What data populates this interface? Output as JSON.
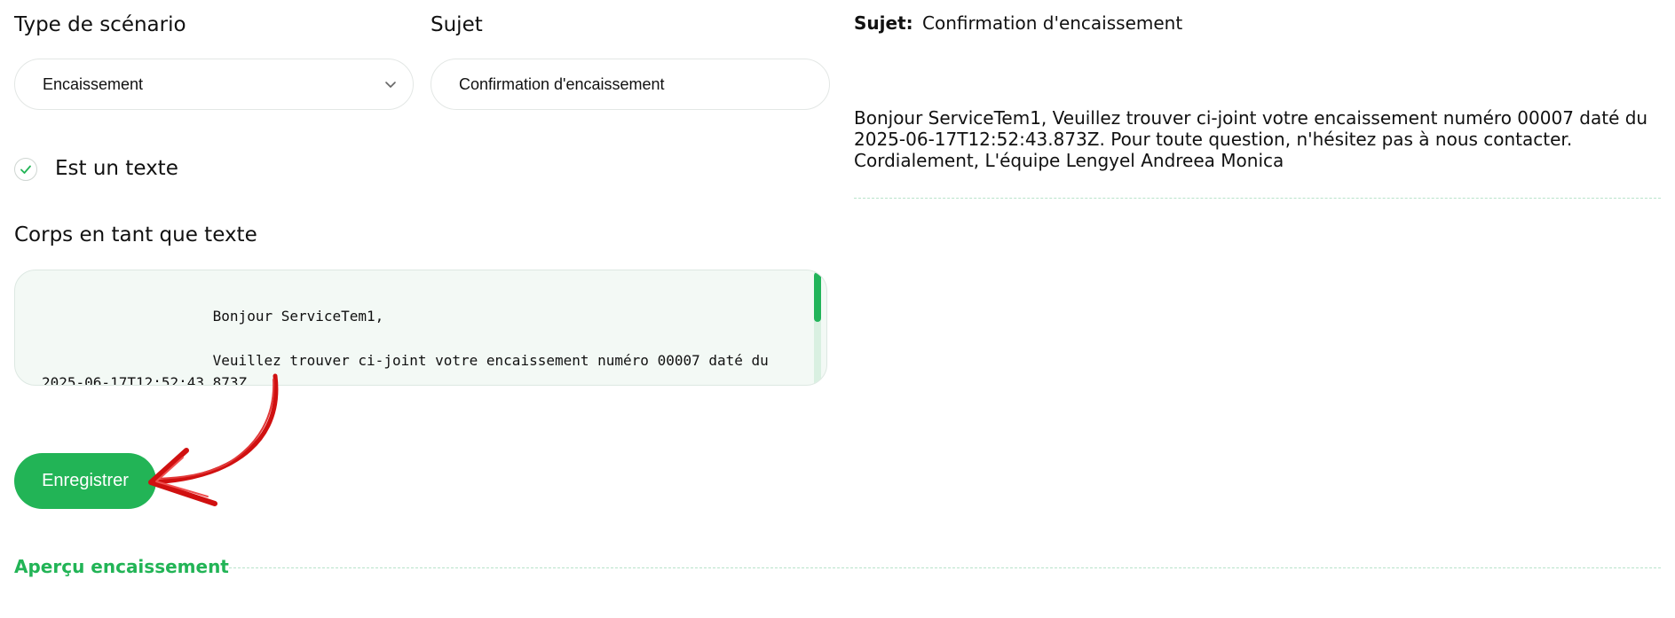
{
  "form": {
    "scenario_type_label": "Type de scénario",
    "scenario_type_value": "Encaissement",
    "subject_label": "Sujet",
    "subject_value": "Confirmation d'encaissement",
    "is_text_label": "Est un texte",
    "is_text_checked": true,
    "body_label": "Corps en tant que texte",
    "body_text": "                    Bonjour ServiceTem1,\n\n                    Veuillez trouver ci-joint votre encaissement numéro 00007 daté du\n2025-06-17T12:52:43.873Z.",
    "save_label": "Enregistrer",
    "preview_section_label": "Aperçu encaissement"
  },
  "preview": {
    "subject_label": "Sujet:",
    "subject_value": "Confirmation d'encaissement",
    "body": "Bonjour ServiceTem1, Veuillez trouver ci-joint votre encaissement numéro 00007 daté du 2025-06-17T12:52:43.873Z. Pour toute question, n'hésitez pas à nous contacter. Cordialement, L'équipe Lengyel Andreea Monica"
  },
  "colors": {
    "accent": "#22b456",
    "textarea_bg": "#f3f9f5",
    "annotation_arrow": "#d01010"
  },
  "icons": {
    "dropdown": "chevron-down-icon",
    "checkbox": "check-icon",
    "annotation": "red-arrow-annotation"
  }
}
